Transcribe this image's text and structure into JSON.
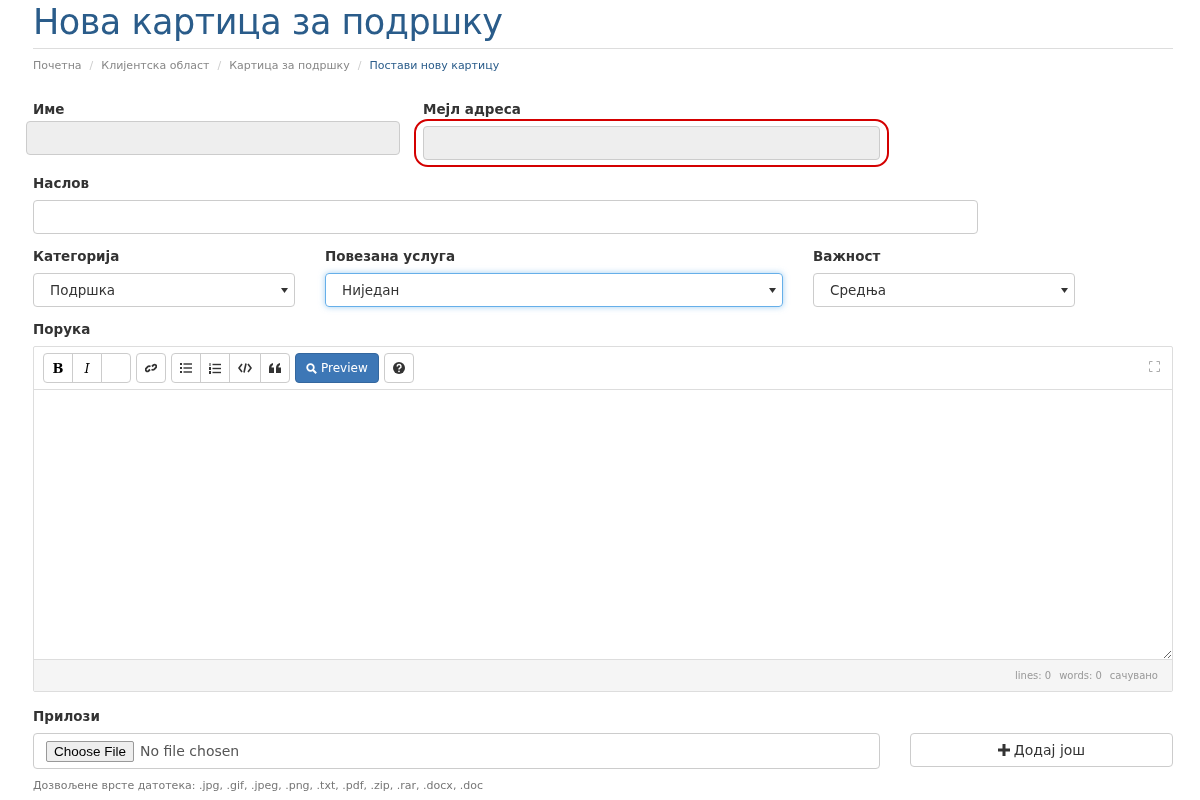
{
  "title": "Нова картица за подршку",
  "breadcrumb_separator": "/",
  "breadcrumb": [
    {
      "label": "Почетна",
      "current": false
    },
    {
      "label": "Клијентска област",
      "current": false
    },
    {
      "label": "Картица за подршку",
      "current": false
    },
    {
      "label": "Постави нову картицу",
      "current": true
    }
  ],
  "contact_fields": [
    {
      "label": "Име",
      "disabled": true,
      "highlighted": false
    },
    {
      "label": "Мејл адреса",
      "disabled": true,
      "highlighted": true
    }
  ],
  "subject": {
    "label": "Наслов"
  },
  "selects": [
    {
      "label": "Категорија",
      "value": "Подршка",
      "focused": false
    },
    {
      "label": "Повезана услуга",
      "value": "Ниједан",
      "focused": true
    },
    {
      "label": "Важност",
      "value": "Средња",
      "focused": false
    }
  ],
  "message": {
    "label": "Порука",
    "toolbar": [
      [
        {
          "kind": "bold",
          "label": "B"
        },
        {
          "kind": "italic",
          "label": "I"
        },
        {
          "kind": "blank"
        }
      ],
      [
        {
          "kind": "link"
        }
      ],
      [
        {
          "kind": "bullet-list"
        },
        {
          "kind": "numbered-list"
        },
        {
          "kind": "code"
        },
        {
          "kind": "quote"
        }
      ],
      [
        {
          "kind": "preview",
          "label": "Preview"
        }
      ],
      [
        {
          "kind": "help"
        }
      ]
    ],
    "status": [
      "lines: 0",
      "words: 0",
      "сачувано"
    ]
  },
  "attachments": {
    "label": "Прилози",
    "choose_button": "Choose File",
    "file_status": "No file chosen",
    "add_button": "Додај још",
    "hint": "Дозвољене врсте датотека: .jpg, .gif, .jpeg, .png, .txt, .pdf, .zip, .rar, .docx, .doc"
  }
}
